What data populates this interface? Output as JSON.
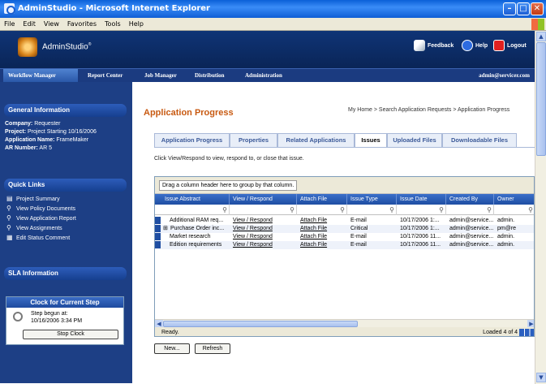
{
  "window": {
    "title": "AdminStudio - Microsoft Internet Explorer",
    "min": "–",
    "max": "□",
    "close": "✕"
  },
  "menu": [
    "File",
    "Edit",
    "View",
    "Favorites",
    "Tools",
    "Help"
  ],
  "header": {
    "brand": "AdminStudio",
    "brand_mark": "®",
    "feedback": "Feedback",
    "help": "Help",
    "logout": "Logout"
  },
  "nav": {
    "tabs": [
      "Workflow Manager",
      "Report Center",
      "Job Manager",
      "Distribution",
      "Administration"
    ],
    "active_tab": "Workflow Manager",
    "user": "admin@servicer.com"
  },
  "sidebar": {
    "general": {
      "title": "General Information",
      "company_label": "Company:",
      "company": "Requester",
      "project_label": "Project:",
      "project": "Project Starting 10/16/2006",
      "app_label": "Application Name:",
      "app": "FrameMaker",
      "ar_label": "AR Number:",
      "ar": "AR 5"
    },
    "quick_links": {
      "title": "Quick Links",
      "items": [
        "Project Summary",
        "View Policy Documents",
        "View Application Report",
        "View Assignments",
        "Edit Status Comment"
      ]
    },
    "sla": {
      "title": "SLA Information"
    },
    "clock": {
      "title": "Clock for Current Step",
      "line1": "Step begun at:",
      "line2": "10/16/2006 3:34 PM",
      "stop": "Stop Clock"
    }
  },
  "main": {
    "title": "Application Progress",
    "breadcrumb": "My Home > Search Application Requests > Application Progress",
    "tabs": [
      "Application Progress",
      "Properties",
      "Related Applications",
      "Issues",
      "Uploaded Files",
      "Downloadable Files"
    ],
    "active_tab": "Issues",
    "hint": "Click View/Respond to view, respond to, or close that issue.",
    "grid": {
      "group_hint": "Drag a column header here to group by that column.",
      "columns": [
        "Issue Abstract",
        "View / Respond",
        "Attach File",
        "Issue Type",
        "Issue Date",
        "Created By",
        "Owner"
      ],
      "rows": [
        [
          "Additional RAM req...",
          "View / Respond",
          "Attach File",
          "E-mail",
          "10/17/2006 1:...",
          "admin@service...",
          "admin."
        ],
        [
          "Purchase Order inc...",
          "View / Respond",
          "Attach File",
          "Critical",
          "10/17/2006 1:...",
          "admin@service...",
          "pm@re"
        ],
        [
          "Market research",
          "View / Respond",
          "Attach File",
          "E-mail",
          "10/17/2006 11...",
          "admin@service...",
          "admin."
        ],
        [
          "Edition requirements",
          "View / Respond",
          "Attach File",
          "E-mail",
          "10/17/2006 11...",
          "admin@service...",
          "admin."
        ]
      ],
      "expand_row": 1,
      "status_left": "Ready.",
      "status_right": "Loaded 4 of 4"
    },
    "buttons": {
      "new": "New...",
      "refresh": "Refresh"
    }
  },
  "colors": {
    "nav_bg": "#1b3b80",
    "sidebar_bg": "#1d3f85",
    "title_orange": "#c85a12",
    "grid_header": "#1f4ea2"
  }
}
